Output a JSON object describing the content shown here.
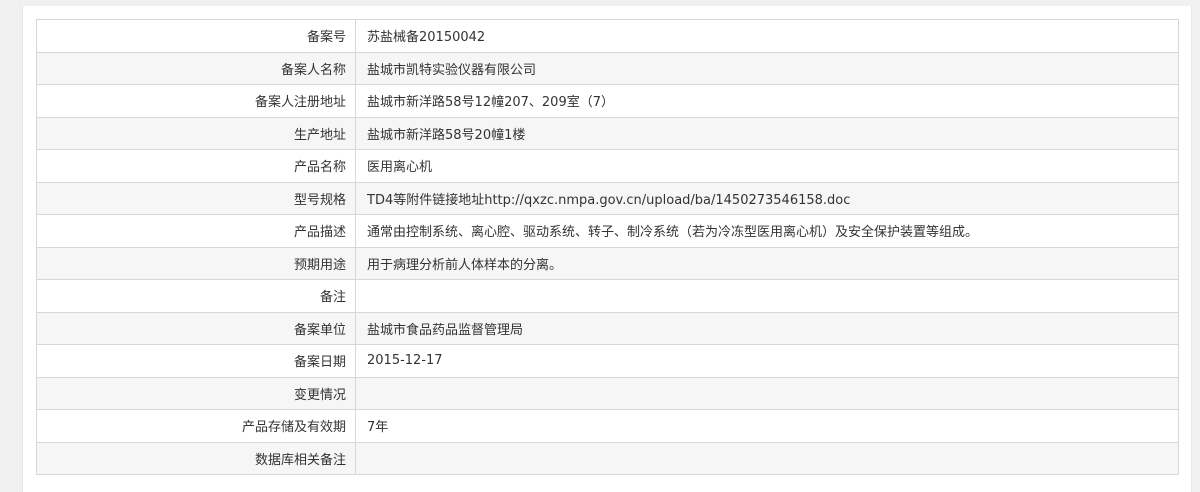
{
  "record": {
    "rows": [
      {
        "label": "备案号",
        "value": "苏盐械备20150042"
      },
      {
        "label": "备案人名称",
        "value": "盐城市凯特实验仪器有限公司"
      },
      {
        "label": "备案人注册地址",
        "value": "盐城市新洋路58号12幢207、209室（7）"
      },
      {
        "label": "生产地址",
        "value": "盐城市新洋路58号20幢1楼"
      },
      {
        "label": "产品名称",
        "value": "医用离心机"
      },
      {
        "label": "型号规格",
        "value": "TD4等附件链接地址http://qxzc.nmpa.gov.cn/upload/ba/1450273546158.doc"
      },
      {
        "label": "产品描述",
        "value": "通常由控制系统、离心腔、驱动系统、转子、制冷系统（若为冷冻型医用离心机）及安全保护装置等组成。"
      },
      {
        "label": "预期用途",
        "value": "用于病理分析前人体样本的分离。"
      },
      {
        "label": "备注",
        "value": ""
      },
      {
        "label": "备案单位",
        "value": "盐城市食品药品监督管理局"
      },
      {
        "label": "备案日期",
        "value": "2015-12-17"
      },
      {
        "label": "变更情况",
        "value": ""
      },
      {
        "label": "产品存储及有效期",
        "value": "7年"
      },
      {
        "label": "数据库相关备注",
        "value": ""
      }
    ]
  }
}
